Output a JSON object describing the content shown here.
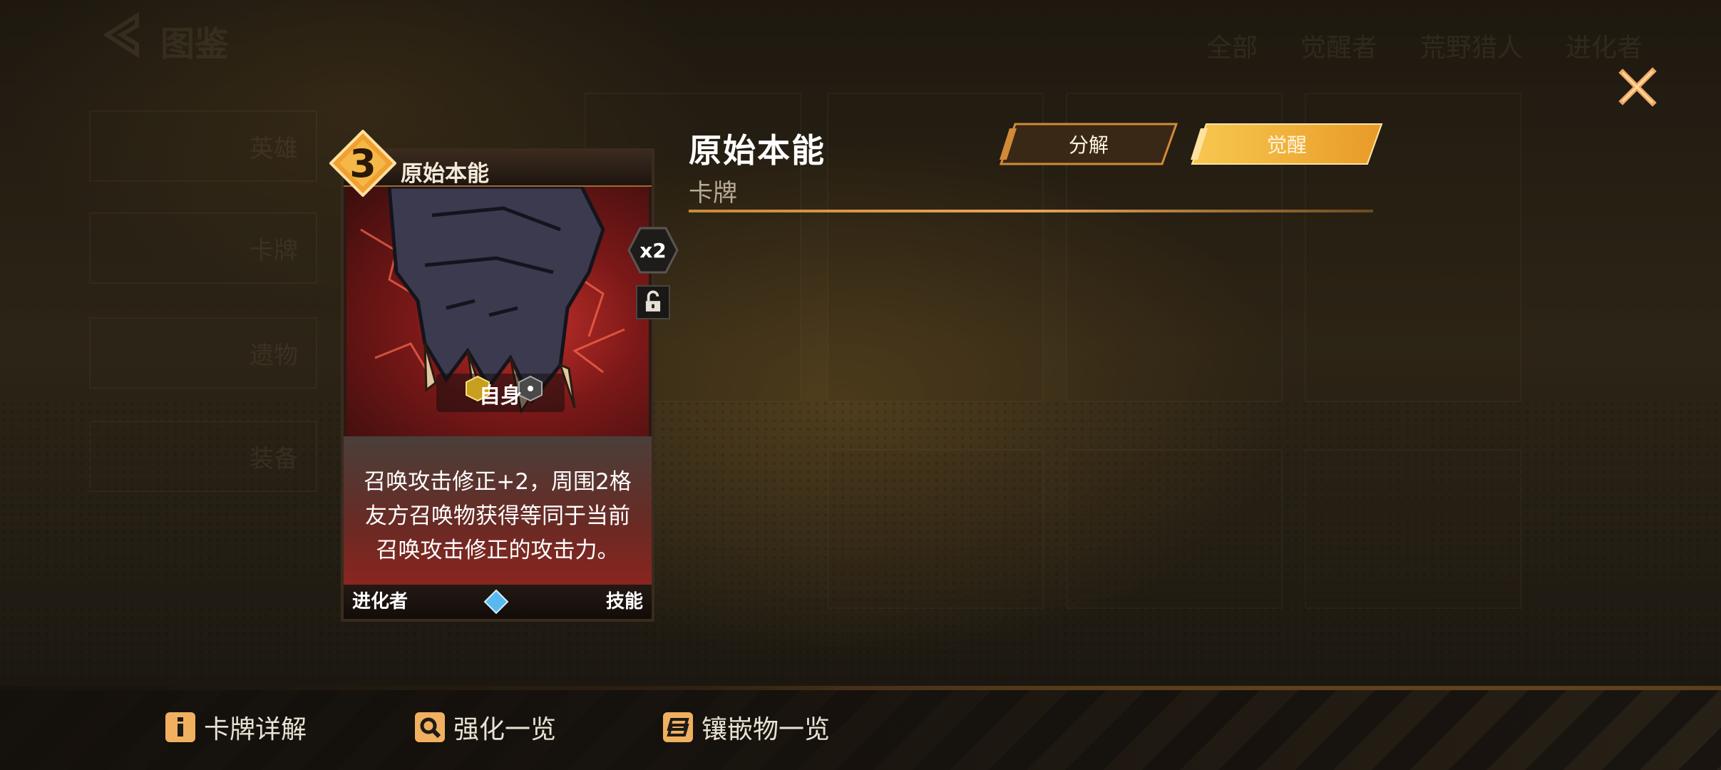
{
  "header": {
    "card_title": "原始本能",
    "card_category": "卡牌",
    "dismantle_label": "分解",
    "awaken_label": "觉醒"
  },
  "background": {
    "page_title": "图鉴",
    "tabs": [
      "全部",
      "觉醒者",
      "荒野猎人",
      "进化者"
    ],
    "sidebar": [
      "英雄",
      "卡牌",
      "遗物",
      "装备"
    ]
  },
  "card": {
    "cost": "3",
    "name": "原始本能",
    "target": "自身",
    "description_lines": [
      "召唤攻击修正+2，周围2格",
      "友方召唤物获得等同于当前",
      "召唤攻击修正的攻击力。"
    ],
    "class": "进化者",
    "type": "技能",
    "count": "x2"
  },
  "bottom_bar": {
    "detail_label": "卡牌详解",
    "enhance_label": "强化一览",
    "inlay_label": "镶嵌物一览"
  },
  "colors": {
    "accent": "#e6a55a",
    "button_gold": "#f0b040"
  }
}
